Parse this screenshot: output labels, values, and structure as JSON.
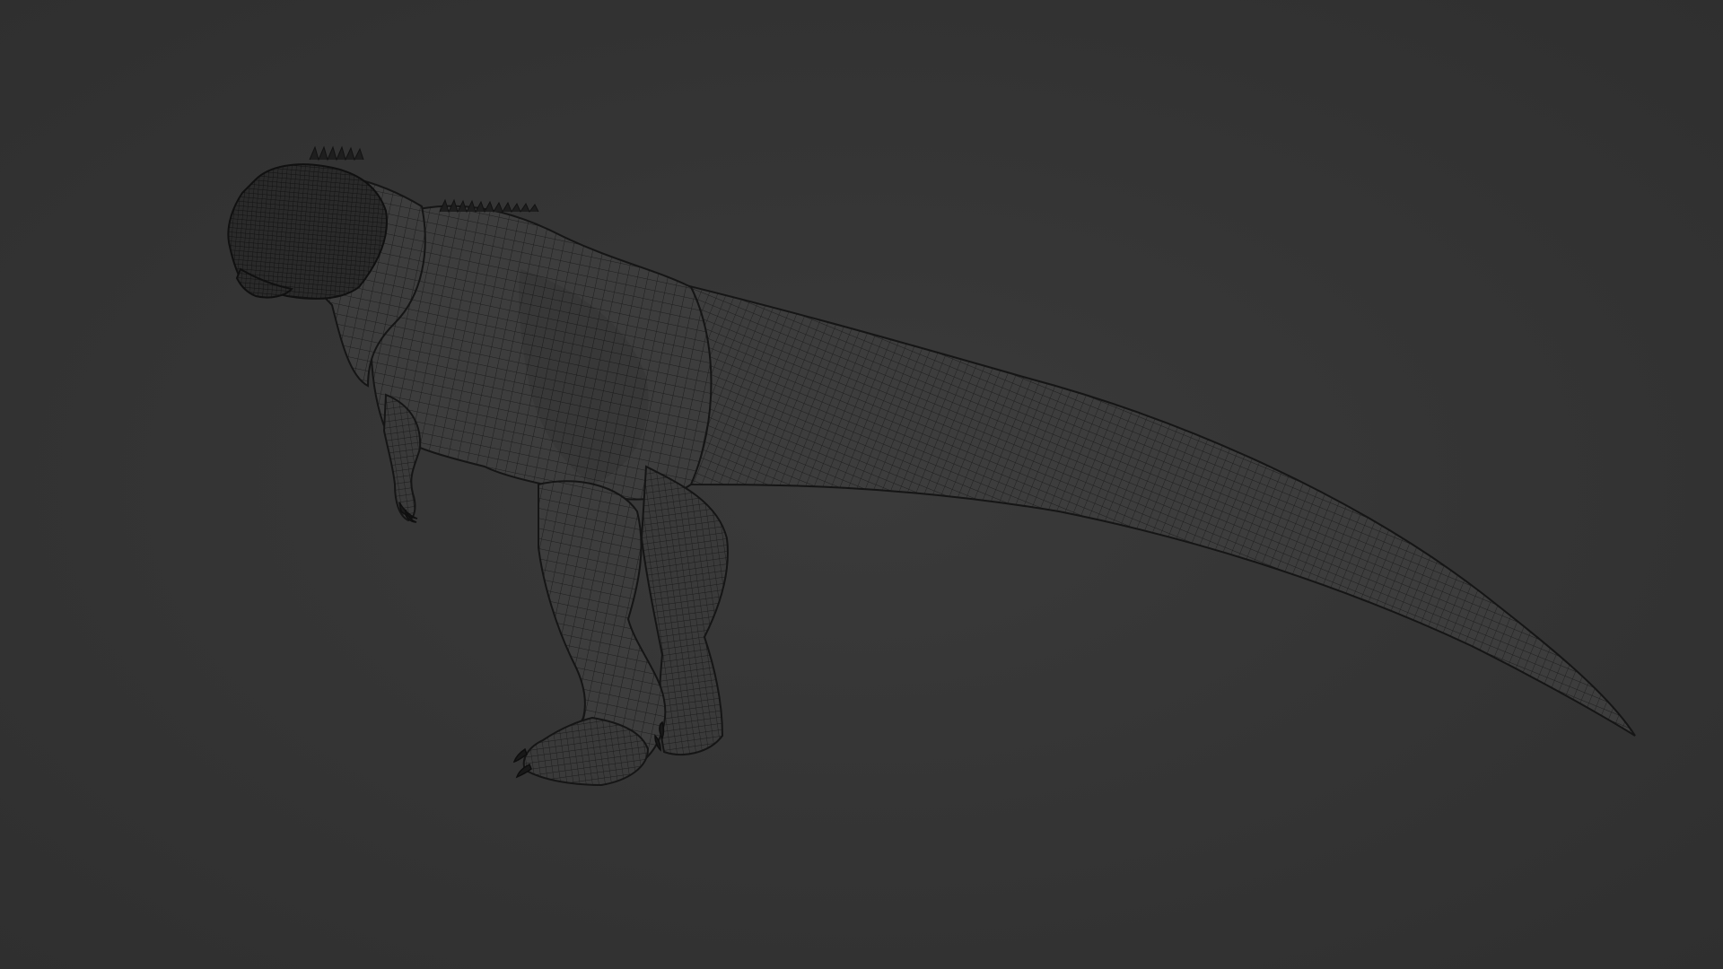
{
  "viewport": {
    "background_color": "#353535",
    "shading_mode": "wireframe",
    "subject": "dinosaur-model"
  },
  "model": {
    "body_fill": "#3c3c3c",
    "wire_color": "#1c1c1c",
    "outline_color": "#141414"
  }
}
